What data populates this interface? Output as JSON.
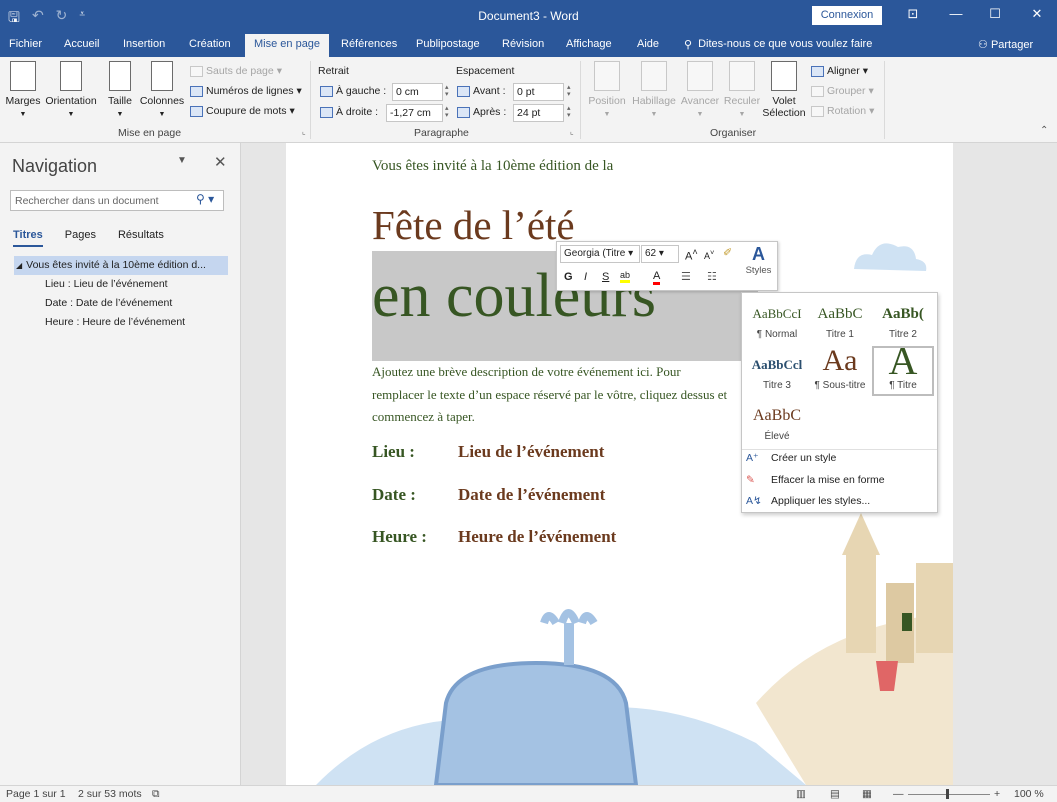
{
  "window": {
    "title": "Document3 - Word",
    "connexion": "Connexion"
  },
  "tabs": [
    "Fichier",
    "Accueil",
    "Insertion",
    "Création",
    "Mise en page",
    "Références",
    "Publipostage",
    "Révision",
    "Affichage",
    "Aide"
  ],
  "active_tab": "Mise en page",
  "tellme": "Dites-nous ce que vous voulez faire",
  "share": "Partager",
  "ribbon": {
    "mise_en_page": {
      "marges": "Marges",
      "orientation": "Orientation",
      "taille": "Taille",
      "colonnes": "Colonnes",
      "sauts": "Sauts de page",
      "numeros": "Numéros de lignes",
      "coupure": "Coupure de mots",
      "group_label": "Mise en page"
    },
    "paragraphe": {
      "retrait": "Retrait",
      "espacement": "Espacement",
      "gauche_label": "À gauche :",
      "gauche_value": "0 cm",
      "droite_label": "À droite :",
      "droite_value": "-1,27 cm",
      "avant_label": "Avant :",
      "avant_value": "0 pt",
      "apres_label": "Après :",
      "apres_value": "24 pt",
      "group_label": "Paragraphe"
    },
    "organiser": {
      "position": "Position",
      "habillage": "Habillage",
      "avancer": "Avancer",
      "reculer": "Reculer",
      "volet": "Volet",
      "selection": "Sélection",
      "aligner": "Aligner",
      "grouper": "Grouper",
      "rotation": "Rotation",
      "group_label": "Organiser"
    }
  },
  "navigation": {
    "title": "Navigation",
    "search_placeholder": "Rechercher dans un document",
    "tabs": [
      "Titres",
      "Pages",
      "Résultats"
    ],
    "tree": {
      "root": "Vous êtes invité à la 10ème édition d...",
      "children": [
        "Lieu : Lieu de l’événement",
        "Date : Date de l’événement",
        "Heure : Heure de l’événement"
      ]
    }
  },
  "document": {
    "intro": "Vous êtes invité à la 10ème édition de la",
    "title": "Fête de l’été",
    "subtitle": "en couleurs",
    "description": "Ajoutez une brève description de votre événement ici. Pour remplacer le texte d’un espace réservé par le vôtre, cliquez dessus et commencez à taper.",
    "rows": [
      {
        "label": "Lieu :",
        "value": "Lieu de l’événement"
      },
      {
        "label": "Date :",
        "value": "Date de l’événement"
      },
      {
        "label": "Heure :",
        "value": "Heure de l’événement"
      }
    ]
  },
  "mini_toolbar": {
    "font": "Georgia (Titre",
    "size": "62",
    "styles": "Styles"
  },
  "styles_gallery": {
    "items": [
      {
        "sample": "AaBbCcI",
        "name": "¶ Normal"
      },
      {
        "sample": "AaBbC",
        "name": "Titre 1"
      },
      {
        "sample": "AaBb(",
        "name": "Titre 2"
      },
      {
        "sample": "AaBbCcl",
        "name": "Titre 3"
      },
      {
        "sample": "Aa",
        "name": "¶ Sous-titre"
      },
      {
        "sample": "A",
        "name": "¶ Titre"
      },
      {
        "sample": "AaBbC",
        "name": "Élevé"
      }
    ],
    "menu": [
      "Créer un style",
      "Effacer la mise en forme",
      "Appliquer les styles..."
    ]
  },
  "status": {
    "page": "Page 1 sur 1",
    "words": "2 sur 53 mots",
    "zoom": "100 %"
  },
  "colors": {
    "brand": "#2b579a",
    "heading_green": "#375623",
    "heading_brown": "#6b3a1e"
  }
}
